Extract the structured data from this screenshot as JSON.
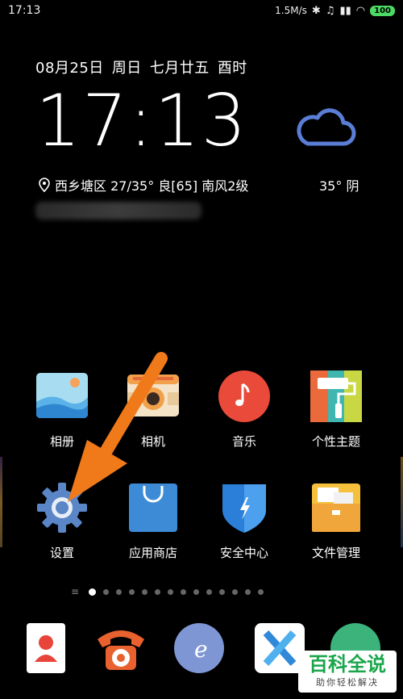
{
  "status_bar": {
    "time": "17:13",
    "net_speed": "1.5M/s",
    "battery": "100"
  },
  "lockwidget": {
    "date": "08月25日",
    "weekday": "周日",
    "lunar": "七月廿五",
    "hour_name": "酉时",
    "clock": "17:13",
    "location": "西乡塘区 27/35° 良[65] 南风2级",
    "temp_now": "35° 阴"
  },
  "apps": [
    {
      "id": "album",
      "label": "相册"
    },
    {
      "id": "camera",
      "label": "相机"
    },
    {
      "id": "music",
      "label": "音乐"
    },
    {
      "id": "theme",
      "label": "个性主题"
    },
    {
      "id": "settings",
      "label": "设置"
    },
    {
      "id": "appstore",
      "label": "应用商店"
    },
    {
      "id": "security",
      "label": "安全中心"
    },
    {
      "id": "files",
      "label": "文件管理"
    }
  ],
  "page_dots": {
    "count": 14,
    "active": 0
  },
  "dock": [
    {
      "id": "contacts",
      "icon": "contacts-icon"
    },
    {
      "id": "phone",
      "icon": "phone-icon"
    },
    {
      "id": "browser",
      "icon": "browser-icon"
    },
    {
      "id": "xapp",
      "icon": "x-app-icon"
    },
    {
      "id": "messages",
      "icon": "messages-icon"
    }
  ],
  "watermark": {
    "big": "百科全说",
    "small": "助你轻松解决"
  },
  "colors": {
    "arrow": "#f07a1a",
    "weather_cloud": "#5a7ed6",
    "watermark_green": "#1aa64b"
  }
}
